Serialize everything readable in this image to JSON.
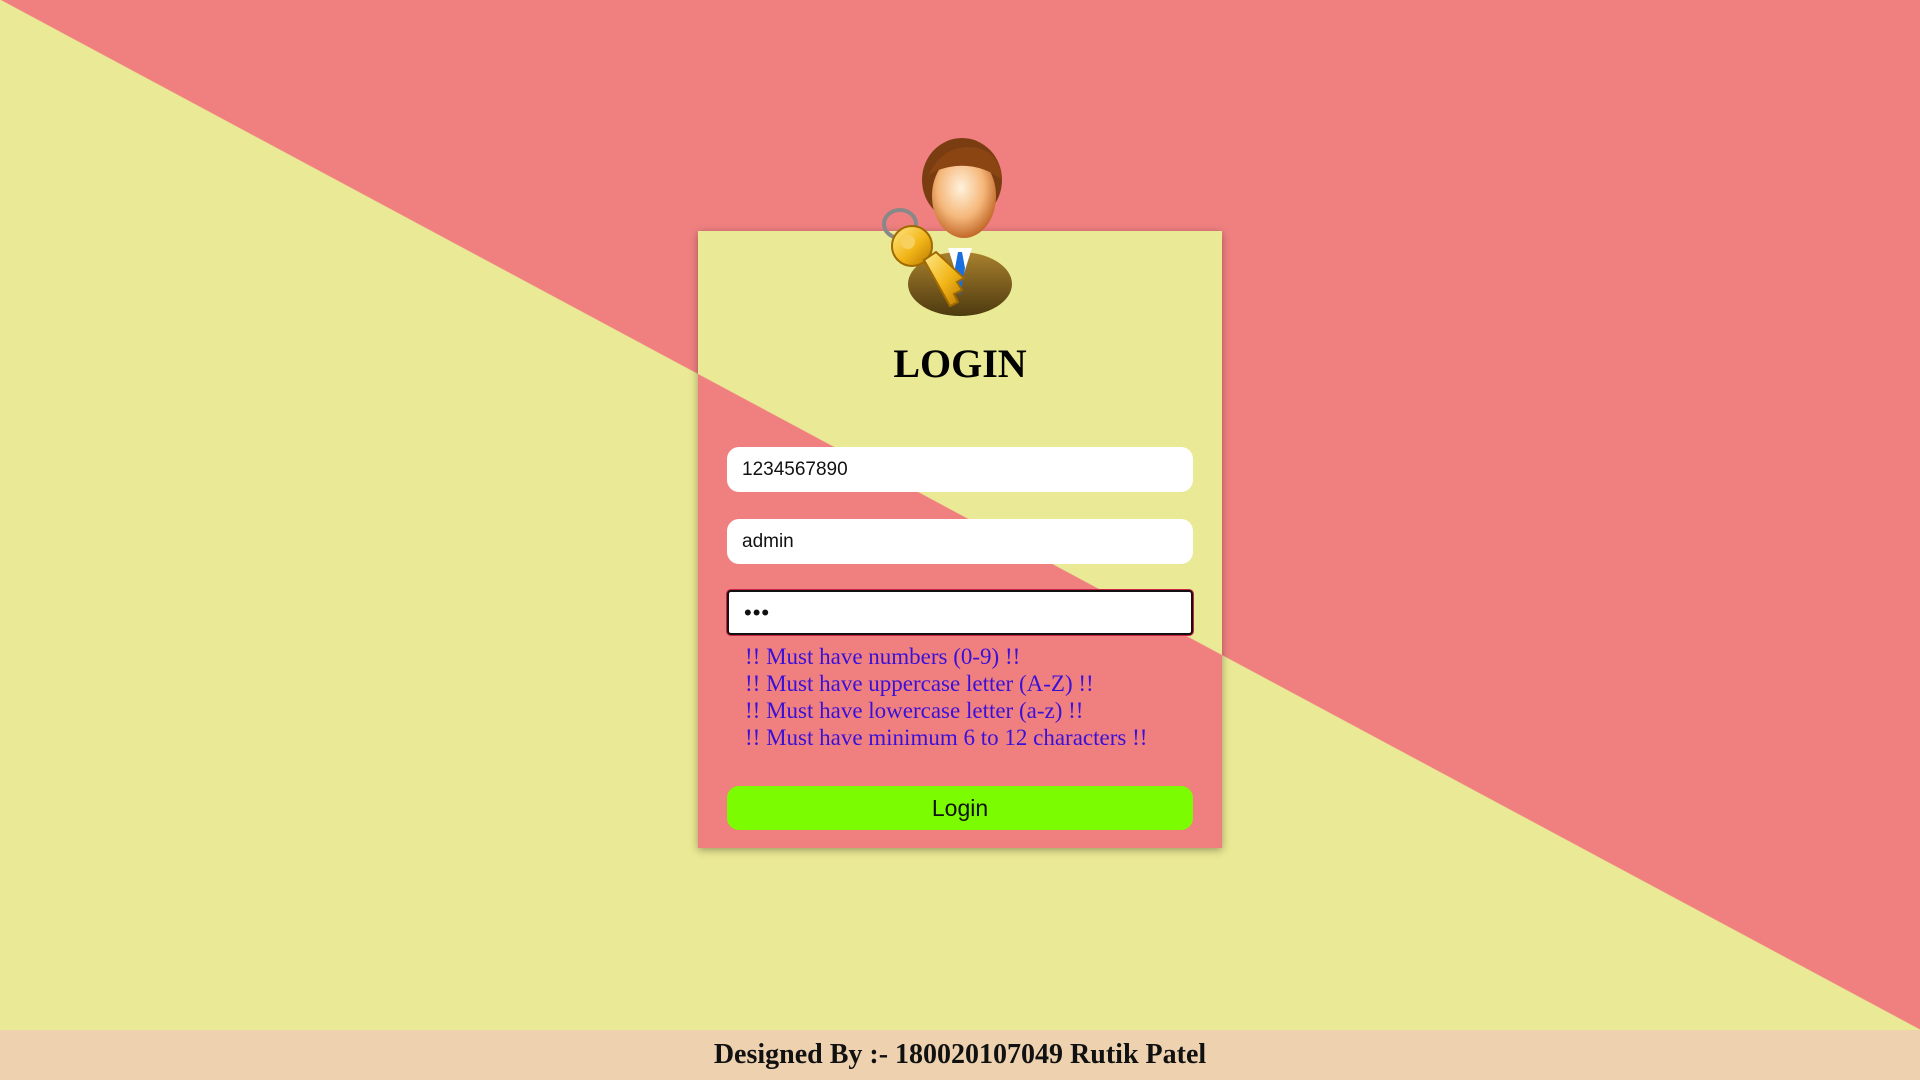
{
  "login_form": {
    "title": "LOGIN",
    "mobile_value": "1234567890",
    "username_value": "admin",
    "password_value": "•••",
    "password_rules": [
      "!! Must have numbers (0-9) !!",
      "!! Must have uppercase letter (A-Z) !!",
      "!! Must have lowercase letter (a-z) !!",
      "!! Must have minimum 6 to 12 characters !!"
    ],
    "login_button": "Login",
    "avatar_icon": "user-with-key-icon"
  },
  "footer": {
    "text": "Designed By :- 180020107049 Rutik Patel"
  },
  "colors": {
    "background_pink": "#f08080",
    "background_yellow": "#eae995",
    "button_green": "#7cfc00",
    "rule_text_blue": "#3a10d8",
    "footer_bg": "#eed2b0"
  }
}
